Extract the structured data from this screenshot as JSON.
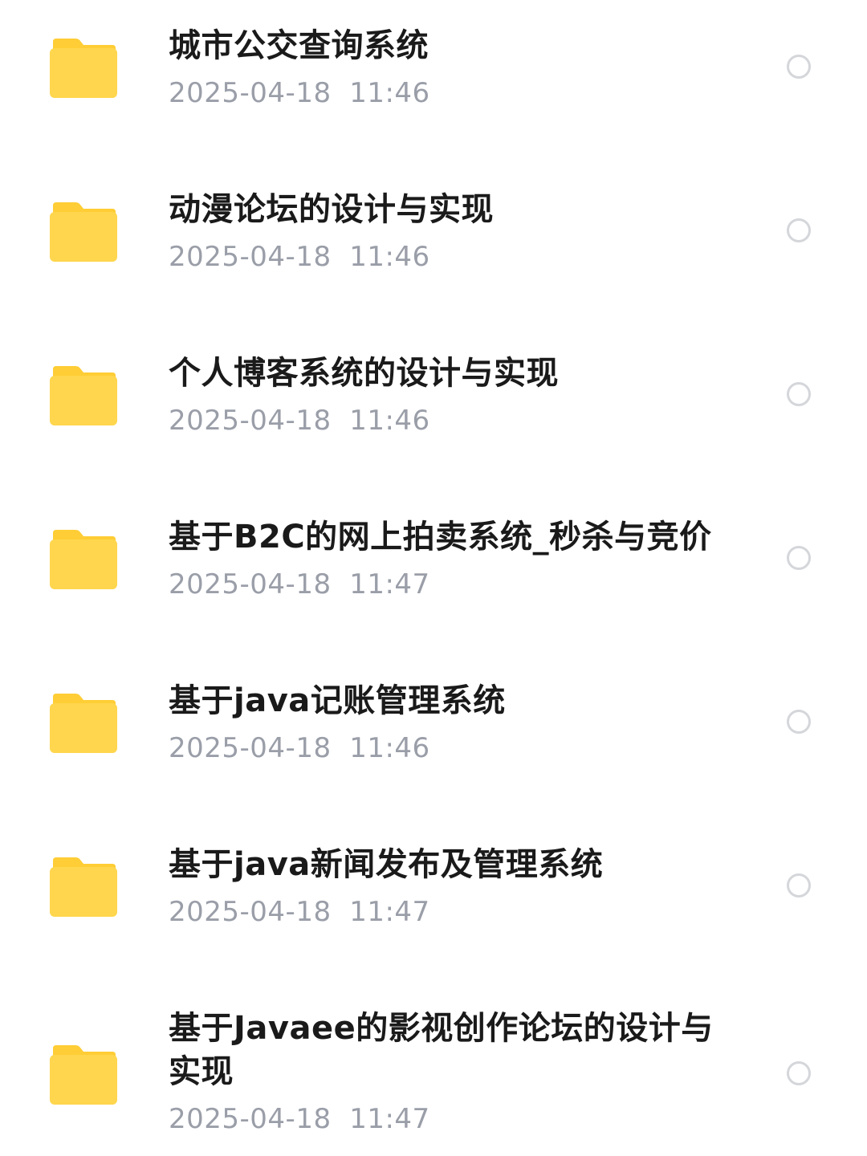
{
  "colors": {
    "folder_body": "#ffd64d",
    "folder_tab": "#ffcd35",
    "title_text": "#1a1a1a",
    "date_text": "#9a9ea8",
    "radio_border": "#d4d6da"
  },
  "files": [
    {
      "title": "城市公交查询系统",
      "date": "2025-04-18  11:46",
      "icon": "folder-icon",
      "selected": false
    },
    {
      "title": "动漫论坛的设计与实现",
      "date": "2025-04-18  11:46",
      "icon": "folder-icon",
      "selected": false
    },
    {
      "title": "个人博客系统的设计与实现",
      "date": "2025-04-18  11:46",
      "icon": "folder-icon",
      "selected": false
    },
    {
      "title": "基于B2C的网上拍卖系统_秒杀与竞价",
      "date": "2025-04-18  11:47",
      "icon": "folder-icon",
      "selected": false
    },
    {
      "title": "基于java记账管理系统",
      "date": "2025-04-18  11:46",
      "icon": "folder-icon",
      "selected": false
    },
    {
      "title": "基于java新闻发布及管理系统",
      "date": "2025-04-18  11:47",
      "icon": "folder-icon",
      "selected": false
    },
    {
      "title": "基于Javaee的影视创作论坛的设计与实现",
      "date": "2025-04-18  11:47",
      "icon": "folder-icon",
      "selected": false
    }
  ]
}
